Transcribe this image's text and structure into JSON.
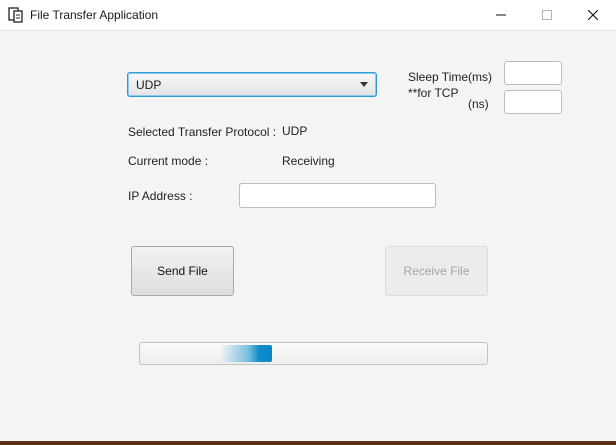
{
  "window": {
    "title": "File Transfer Application"
  },
  "protocol_select": {
    "value": "UDP"
  },
  "sleep_time": {
    "label_line1": "Sleep Time(ms)",
    "label_line2": "**for TCP",
    "label_ns": "(ns)",
    "ms_value": "",
    "ns_value": ""
  },
  "status": {
    "protocol_label": "Selected Transfer Protocol :",
    "protocol_value": "UDP",
    "mode_label": "Current mode :",
    "mode_value": "Receiving"
  },
  "ip": {
    "label": "IP Address :",
    "value": ""
  },
  "buttons": {
    "send": "Send File",
    "receive": "Receive File",
    "receive_enabled": false
  },
  "progress": {
    "mode": "indeterminate",
    "accent_color": "#0e8ecb"
  },
  "colors": {
    "focus_border": "#2b9bd6",
    "disabled_text": "#a4a4a4"
  },
  "icons": {
    "app": "file-transfer-icon",
    "minimize": "minimize-icon",
    "maximize": "maximize-icon",
    "close": "close-icon",
    "dropdown": "chevron-down-icon"
  }
}
